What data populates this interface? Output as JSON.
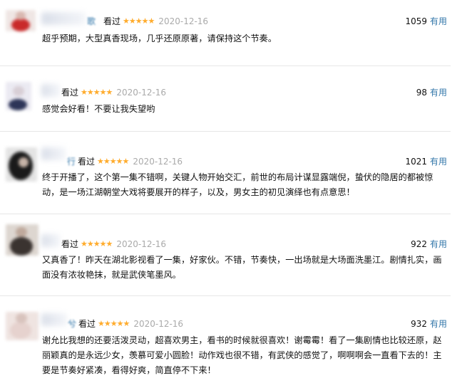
{
  "comments": [
    {
      "user_tail": "歌",
      "seen_label": "看过",
      "stars": "★★★★★",
      "date": "2020-12-16",
      "votes": "1059",
      "useful_label": "有用",
      "text": "超乎预期，大型真香现场，几乎还原原著，请保持这个节奏。"
    },
    {
      "user_tail": "",
      "seen_label": "看过",
      "stars": "★★★★★",
      "date": "2020-12-16",
      "votes": "98",
      "useful_label": "有用",
      "text": "感觉会好看！不要让我失望哟"
    },
    {
      "user_tail": "行",
      "seen_label": "看过",
      "stars": "★★★★★",
      "date": "2020-12-16",
      "votes": "1021",
      "useful_label": "有用",
      "text": "终于开播了，这个第一集不错啊，关键人物开始交汇，前世的布局计谋显露端倪，蛰伏的隐居的都被惊动，是一场江湖朝堂大戏将要展开的样子，以及，男女主的初见演绎也有点意思！"
    },
    {
      "user_tail": "",
      "seen_label": "看过",
      "stars": "★★★★★",
      "date": "2020-12-16",
      "votes": "922",
      "useful_label": "有用",
      "text": "又真香了！昨天在湖北影视看了一集，好家伙。不错，节奏快，一出场就是大场面洗墨江。剧情扎实，画面没有浓妆艳抹，就是武侠笔墨风。"
    },
    {
      "user_tail": "兮",
      "seen_label": "看过",
      "stars": "★★★★★",
      "date": "2020-12-16",
      "votes": "932",
      "useful_label": "有用",
      "text": "谢允比我想的还要活泼灵动，超喜欢男主，看书的时候就很喜欢！谢霉霉！看了一集剧情也比较还原，赵丽颖真的是永远少女，羡慕可爱小圆脸！动作戏也很不错，有武侠的感觉了，啊啊啊会一直看下去的！主要是节奏好紧凑，看得好爽，简直停不下来！"
    }
  ]
}
